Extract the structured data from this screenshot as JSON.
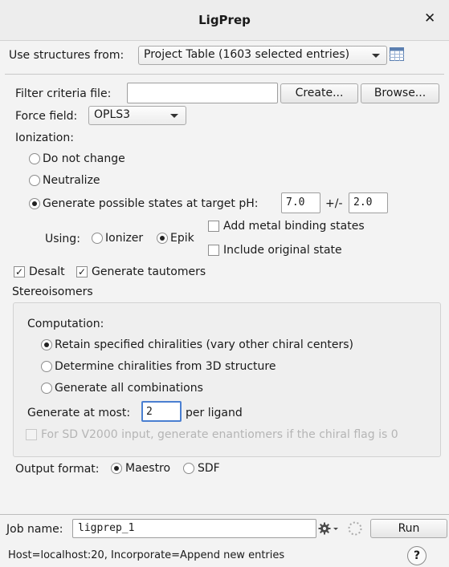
{
  "window": {
    "title": "LigPrep"
  },
  "structures": {
    "label": "Use structures from:",
    "selected": "Project Table (1603 selected entries)"
  },
  "filter": {
    "label": "Filter criteria file:",
    "value": "",
    "create_label": "Create...",
    "browse_label": "Browse..."
  },
  "force_field": {
    "label": "Force field:",
    "selected": "OPLS3"
  },
  "ionization": {
    "header": "Ionization:",
    "opt_no_change": "Do not change",
    "opt_neutralize": "Neutralize",
    "opt_generate": "Generate possible states at target pH:",
    "selected": "opt_generate",
    "ph_value": "7.0",
    "pm_label": "+/-",
    "tol_value": "2.0",
    "using_label": "Using:",
    "ionizer_label": "Ionizer",
    "epik_label": "Epik",
    "using_selected": "Epik",
    "metal_binding_label": "Add metal binding states",
    "metal_binding_checked": false,
    "include_original_label": "Include original state",
    "include_original_checked": false
  },
  "desalt": {
    "label": "Desalt",
    "checked": true
  },
  "tautomers": {
    "label": "Generate tautomers",
    "checked": true
  },
  "stereo": {
    "header": "Stereoisomers",
    "computation_label": "Computation:",
    "opt_retain": "Retain specified chiralities (vary other chiral centers)",
    "opt_determine": "Determine chiralities from 3D structure",
    "opt_all": "Generate all combinations",
    "selected": "opt_retain",
    "at_most_label": "Generate at most:",
    "at_most_value": "2",
    "per_ligand_label": "per ligand",
    "sd_label": "For SD V2000 input, generate enantiomers if the chiral flag is 0",
    "sd_checked": false
  },
  "output": {
    "label": "Output format:",
    "maestro_label": "Maestro",
    "sdf_label": "SDF",
    "selected": "Maestro"
  },
  "job": {
    "label": "Job name:",
    "value": "ligprep_1",
    "run_label": "Run"
  },
  "status": {
    "text": "Host=localhost:20, Incorporate=Append new entries"
  },
  "icons": {
    "close": "close-icon",
    "table": "table-icon",
    "gear": "gear-icon",
    "spinner": "spinner-icon",
    "help": "help-icon"
  }
}
